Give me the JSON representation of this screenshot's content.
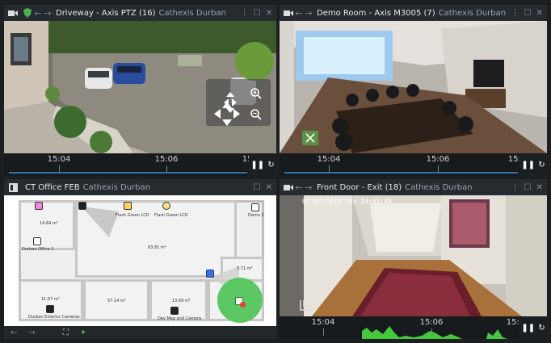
{
  "panes": {
    "driveway": {
      "title": "Driveway - Axis PTZ (16)",
      "site": "Cathexis Durban",
      "timeline": {
        "labels": [
          "15:04",
          "15:06",
          "15:0"
        ]
      }
    },
    "demo_room": {
      "title": "Demo Room - Axis M3005 (7)",
      "site": "Cathexis Durban",
      "timeline": {
        "labels": [
          "15:04",
          "15:06",
          "15:0"
        ]
      }
    },
    "office_map": {
      "title": "CT Office FEB",
      "site": "Cathexis Durban",
      "rooms": {
        "r1": "14.64 m²",
        "office": "Durban Office 2",
        "main": "93.81 m²",
        "small": "3.71 m²",
        "bl": "11.67 m²",
        "bm": "57.14 m²",
        "bc": "13.69 m²"
      },
      "cameras": {
        "flash1": "Flash Green LCD",
        "flash2": "Flash Green LCD",
        "demo2": "Demo 2",
        "ext": "Durban Exterior Cameras",
        "dev": "Dev Map and Camera"
      }
    },
    "front_door": {
      "title": "Front Door - Exit (18)",
      "site": "Cathexis Durban",
      "osd": "01-07-2022 Thu 14:53:38",
      "timeline": {
        "labels": [
          "15:04",
          "15:06",
          "15:0"
        ]
      }
    }
  },
  "colors": {
    "accent_green": "#4caf50",
    "timeline_blue": "#3d8fd1",
    "activity_green": "#46c83c"
  },
  "icons": [
    "video-camera-icon",
    "back-arrow-icon",
    "forward-arrow-icon",
    "more-icon",
    "maximize-icon",
    "close-icon",
    "zoom-in-icon",
    "zoom-out-icon",
    "pause-icon",
    "loop-icon",
    "map-icon",
    "fullscreen-icon",
    "wifi-icon"
  ]
}
